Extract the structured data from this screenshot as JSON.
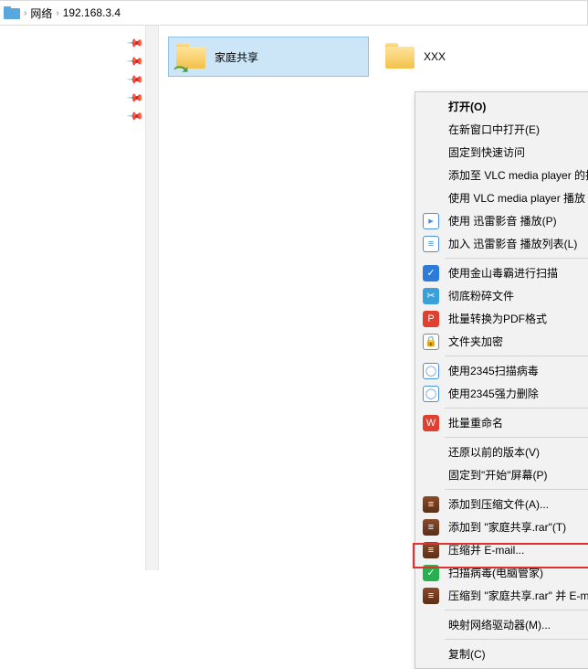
{
  "address": {
    "segment1": "网络",
    "segment2": "192.168.3.4"
  },
  "folders": {
    "item1": "家庭共享",
    "item2": "XXX"
  },
  "ctx": {
    "open": "打开(O)",
    "newwin": "在新窗口中打开(E)",
    "pinqa": "固定到快速访问",
    "vlcadd": "添加至 VLC media player 的播放列表",
    "vlcplay": "使用 VLC media player 播放",
    "xlplay": "使用 迅雷影音 播放(P)",
    "xllist": "加入 迅雷影音 播放列表(L)",
    "jinshan": "使用金山毒霸进行扫描",
    "shred": "彻底粉碎文件",
    "pdf": "批量转换为PDF格式",
    "encrypt": "文件夹加密",
    "scan2345": "使用2345扫描病毒",
    "del2345": "使用2345强力删除",
    "wpsrename": "批量重命名",
    "prev": "还原以前的版本(V)",
    "pinstart": "固定到\"开始\"屏幕(P)",
    "addarc": "添加到压缩文件(A)...",
    "addrar": "添加到 \"家庭共享.rar\"(T)",
    "zipmail": "压缩并 E-mail...",
    "scanvirus": "扫描病毒(电脑管家)",
    "zipmailto": "压缩到 \"家庭共享.rar\" 并 E-mail",
    "mapnet": "映射网络驱动器(M)...",
    "copy": "复制(C)"
  }
}
